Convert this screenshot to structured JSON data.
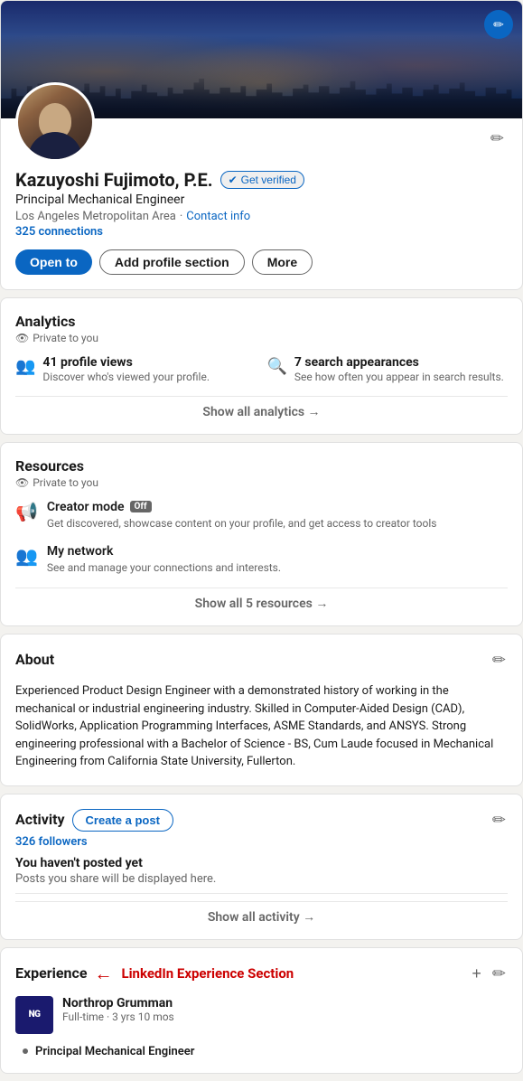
{
  "profile": {
    "name": "Kazuyoshi Fujimoto, P.E.",
    "headline": "Principal Mechanical Engineer",
    "location": "Los Angeles Metropolitan Area",
    "contact_link": "Contact info",
    "connections": "325 connections",
    "verified_label": "Get verified",
    "actions": {
      "open_to": "Open to",
      "add_section": "Add profile section",
      "more": "More"
    }
  },
  "analytics": {
    "title": "Analytics",
    "private_label": "Private to you",
    "profile_views_count": "41 profile views",
    "profile_views_desc": "Discover who's viewed your profile.",
    "search_count": "7 search appearances",
    "search_desc": "See how often you appear in search results.",
    "show_all": "Show all analytics →"
  },
  "resources": {
    "title": "Resources",
    "private_label": "Private to you",
    "creator_mode_label": "Creator mode",
    "creator_mode_badge": "Off",
    "creator_mode_desc": "Get discovered, showcase content on your profile, and get access to creator tools",
    "my_network_label": "My network",
    "my_network_desc": "See and manage your connections and interests.",
    "show_all": "Show all 5 resources →"
  },
  "about": {
    "title": "About",
    "text": "Experienced Product Design Engineer with a demonstrated history of working in the mechanical or industrial engineering industry. Skilled in Computer-Aided Design (CAD), SolidWorks, Application Programming Interfaces, ASME Standards, and ANSYS. Strong engineering professional with a Bachelor of Science - BS, Cum Laude focused in Mechanical Engineering from California State University, Fullerton."
  },
  "activity": {
    "title": "Activity",
    "followers": "326 followers",
    "create_post": "Create a post",
    "no_post_title": "You haven't posted yet",
    "no_post_desc": "Posts you share will be displayed here.",
    "show_all": "Show all activity →"
  },
  "experience": {
    "title": "Experience",
    "annotation": "LinkedIn Experience Section",
    "company": "Northrop Grumman",
    "job_type": "Full-time · 3 yrs 10 mos",
    "job_title": "Principal Mechanical Engineer",
    "company_logo_text": "NG"
  }
}
